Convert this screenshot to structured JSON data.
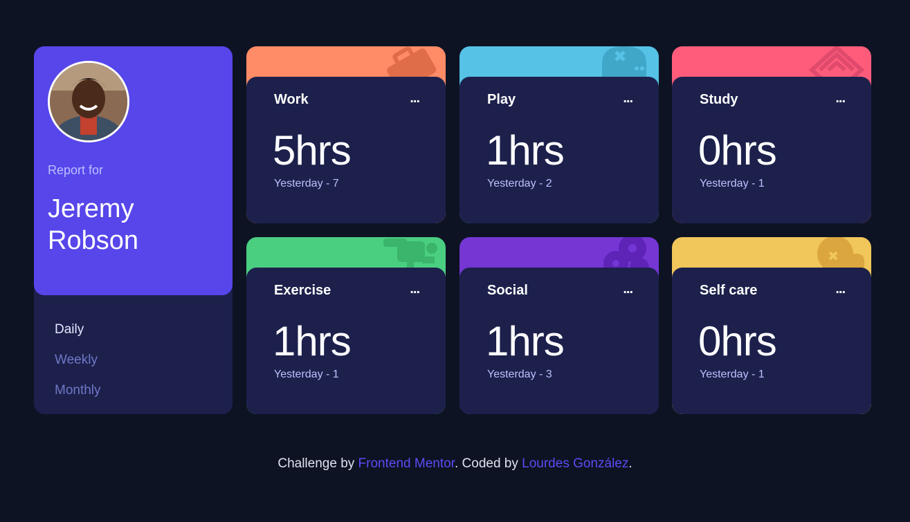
{
  "profile": {
    "report_for": "Report for",
    "name": "Jeremy Robson",
    "avatar_alt": "avatar"
  },
  "periods": [
    {
      "label": "Daily",
      "active": true
    },
    {
      "label": "Weekly",
      "active": false
    },
    {
      "label": "Monthly",
      "active": false
    }
  ],
  "activities": [
    {
      "title": "Work",
      "hours": "5hrs",
      "previous": "Yesterday - 7",
      "color": "#ff8c66",
      "icon": "briefcase-icon",
      "menu": "..."
    },
    {
      "title": "Play",
      "hours": "1hrs",
      "previous": "Yesterday - 2",
      "color": "#56c2e6",
      "icon": "gamepad-icon",
      "menu": "..."
    },
    {
      "title": "Study",
      "hours": "0hrs",
      "previous": "Yesterday - 1",
      "color": "#ff5c7c",
      "icon": "books-icon",
      "menu": "..."
    },
    {
      "title": "Exercise",
      "hours": "1hrs",
      "previous": "Yesterday - 1",
      "color": "#4acf81",
      "icon": "running-icon",
      "menu": "..."
    },
    {
      "title": "Social",
      "hours": "1hrs",
      "previous": "Yesterday - 3",
      "color": "#7536d3",
      "icon": "social-icon",
      "menu": "..."
    },
    {
      "title": "Self care",
      "hours": "0hrs",
      "previous": "Yesterday - 1",
      "color": "#f1c65b",
      "icon": "self-care-icon",
      "menu": "..."
    }
  ],
  "footer": {
    "prefix": "Challenge by",
    "link1": "Frontend Mentor",
    "middle": ". Coded by",
    "link2": "Lourdes González",
    "suffix": "."
  }
}
